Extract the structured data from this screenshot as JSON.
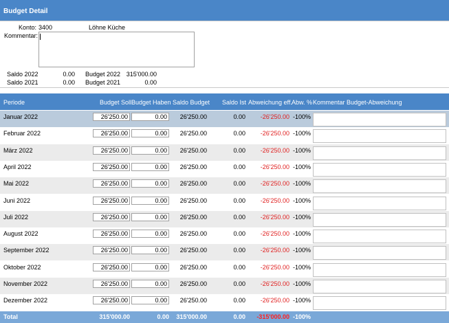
{
  "window": {
    "title": "Budget Detail"
  },
  "info": {
    "konto_label": "Konto:",
    "konto_value": "3400",
    "konto_name": "Löhne Küche",
    "kommentar_label": "Kommentar:",
    "kommentar_value": "",
    "summary": [
      {
        "label": "Saldo 2022",
        "value": "0.00",
        "label2": "Budget 2022",
        "value2": "315'000.00"
      },
      {
        "label": "Saldo 2021",
        "value": "0.00",
        "label2": "Budget 2021",
        "value2": "0.00"
      }
    ]
  },
  "table": {
    "headers": {
      "periode": "Periode",
      "budget_soll": "Budget Soll",
      "budget_haben": "Budget Haben",
      "saldo_budget": "Saldo Budget",
      "saldo_ist": "Saldo Ist",
      "abweichung_eff": "Abweichung eff.",
      "abw_pct": "Abw. %",
      "kommentar": "Kommentar Budget-Abweichung"
    },
    "rows": [
      {
        "periode": "Januar 2022",
        "soll": "26'250.00",
        "haben": "0.00",
        "saldo_budget": "26'250.00",
        "saldo_ist": "0.00",
        "abweichung": "-26'250.00",
        "pct": "-100%",
        "kommentar": ""
      },
      {
        "periode": "Februar 2022",
        "soll": "26'250.00",
        "haben": "0.00",
        "saldo_budget": "26'250.00",
        "saldo_ist": "0.00",
        "abweichung": "-26'250.00",
        "pct": "-100%",
        "kommentar": ""
      },
      {
        "periode": "März 2022",
        "soll": "26'250.00",
        "haben": "0.00",
        "saldo_budget": "26'250.00",
        "saldo_ist": "0.00",
        "abweichung": "-26'250.00",
        "pct": "-100%",
        "kommentar": ""
      },
      {
        "periode": "April 2022",
        "soll": "26'250.00",
        "haben": "0.00",
        "saldo_budget": "26'250.00",
        "saldo_ist": "0.00",
        "abweichung": "-26'250.00",
        "pct": "-100%",
        "kommentar": ""
      },
      {
        "periode": "Mai 2022",
        "soll": "26'250.00",
        "haben": "0.00",
        "saldo_budget": "26'250.00",
        "saldo_ist": "0.00",
        "abweichung": "-26'250.00",
        "pct": "-100%",
        "kommentar": ""
      },
      {
        "periode": "Juni 2022",
        "soll": "26'250.00",
        "haben": "0.00",
        "saldo_budget": "26'250.00",
        "saldo_ist": "0.00",
        "abweichung": "-26'250.00",
        "pct": "-100%",
        "kommentar": ""
      },
      {
        "periode": "Juli 2022",
        "soll": "26'250.00",
        "haben": "0.00",
        "saldo_budget": "26'250.00",
        "saldo_ist": "0.00",
        "abweichung": "-26'250.00",
        "pct": "-100%",
        "kommentar": ""
      },
      {
        "periode": "August 2022",
        "soll": "26'250.00",
        "haben": "0.00",
        "saldo_budget": "26'250.00",
        "saldo_ist": "0.00",
        "abweichung": "-26'250.00",
        "pct": "-100%",
        "kommentar": ""
      },
      {
        "periode": "September 2022",
        "soll": "26'250.00",
        "haben": "0.00",
        "saldo_budget": "26'250.00",
        "saldo_ist": "0.00",
        "abweichung": "-26'250.00",
        "pct": "-100%",
        "kommentar": ""
      },
      {
        "periode": "Oktober 2022",
        "soll": "26'250.00",
        "haben": "0.00",
        "saldo_budget": "26'250.00",
        "saldo_ist": "0.00",
        "abweichung": "-26'250.00",
        "pct": "-100%",
        "kommentar": ""
      },
      {
        "periode": "November 2022",
        "soll": "26'250.00",
        "haben": "0.00",
        "saldo_budget": "26'250.00",
        "saldo_ist": "0.00",
        "abweichung": "-26'250.00",
        "pct": "-100%",
        "kommentar": ""
      },
      {
        "periode": "Dezember 2022",
        "soll": "26'250.00",
        "haben": "0.00",
        "saldo_budget": "26'250.00",
        "saldo_ist": "0.00",
        "abweichung": "-26'250.00",
        "pct": "-100%",
        "kommentar": ""
      }
    ],
    "total": {
      "label": "Total",
      "soll": "315'000.00",
      "haben": "0.00",
      "saldo_budget": "315'000.00",
      "saldo_ist": "0.00",
      "abweichung": "-315'000.00",
      "pct": "-100%"
    },
    "selected_row": 0
  },
  "colors": {
    "header_blue": "#4a86c8",
    "total_blue": "#7aa8d8",
    "selected_row": "#bacbdc",
    "alt_row": "#ebebeb",
    "negative": "#e02020"
  }
}
